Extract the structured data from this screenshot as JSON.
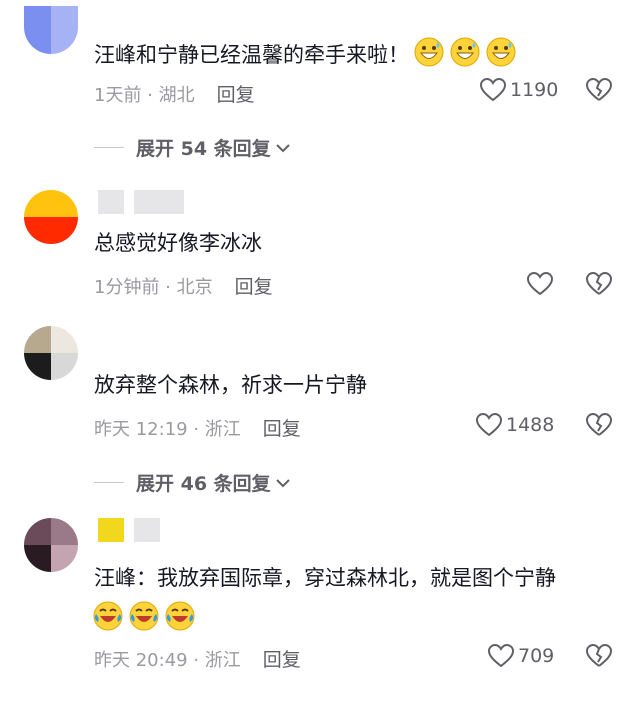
{
  "comments": [
    {
      "text": "汪峰和宁静已经温馨的牵手来啦！",
      "emojis": [
        "grin-sweat-emoji",
        "grin-sweat-emoji",
        "grin-sweat-emoji"
      ],
      "time_location": "1天前 · 湖北",
      "reply_label": "回复",
      "like_count": "1190",
      "expand_label": "展开 54 条回复"
    },
    {
      "text": "总感觉好像李冰冰",
      "time_location": "1分钟前 · 北京",
      "reply_label": "回复",
      "like_count": ""
    },
    {
      "text": "放弃整个森林，祈求一片宁静",
      "time_location": "昨天 12:19 · 浙江",
      "reply_label": "回复",
      "like_count": "1488",
      "expand_label": "展开 46 条回复"
    },
    {
      "text": "汪峰：我放弃国际章，穿过森林北，就是图个宁静",
      "emojis": [
        "laugh-cry-emoji",
        "laugh-cry-emoji",
        "laugh-cry-emoji"
      ],
      "time_location": "昨天 20:49 · 浙江",
      "reply_label": "回复",
      "like_count": "709"
    }
  ],
  "colors": {
    "text": "#161823",
    "meta": "#9a9aa0",
    "action": "#5f5f66"
  }
}
